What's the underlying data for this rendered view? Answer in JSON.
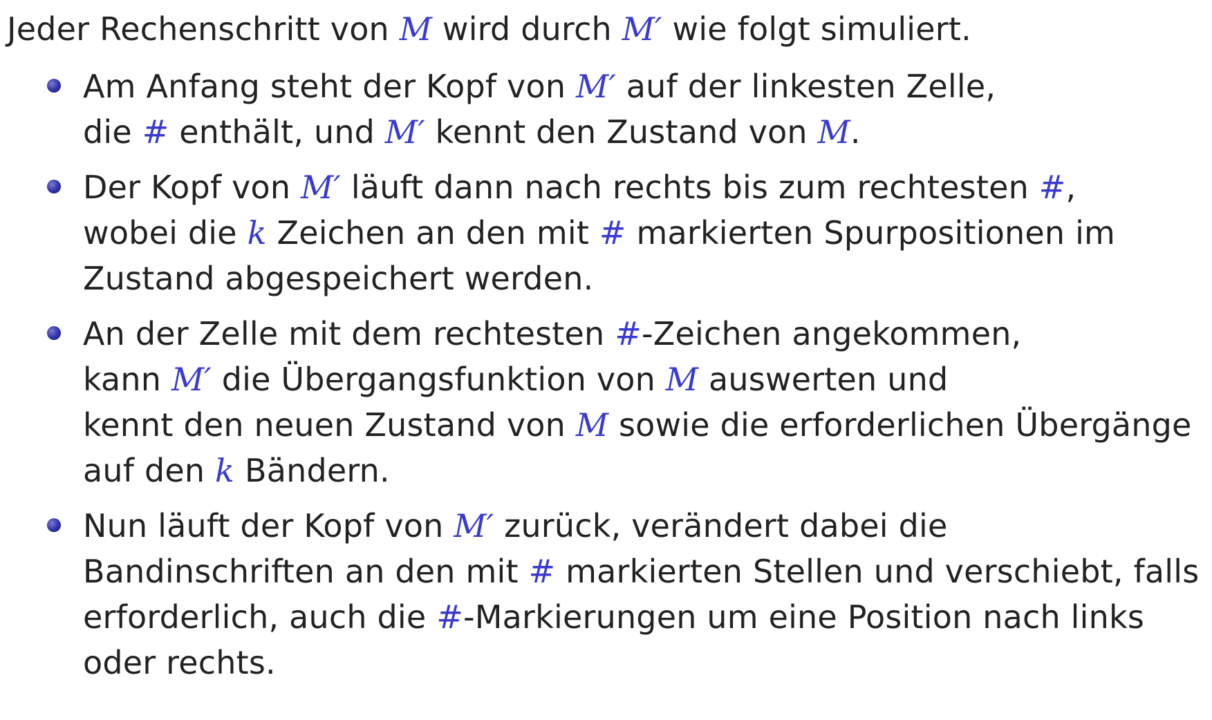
{
  "intro": {
    "parts": [
      "Jeder Rechenschritt von ",
      "M",
      " wird durch ",
      "M′",
      " wie folgt simuliert."
    ]
  },
  "bullets": [
    {
      "lines": [
        [
          "Am Anfang steht der Kopf von ",
          "M′",
          " auf der linkesten Zelle,"
        ],
        [
          "die ",
          "#",
          " enthält, und ",
          "M′",
          " kennt den Zustand von ",
          "M",
          "."
        ]
      ]
    },
    {
      "lines": [
        [
          "Der Kopf von ",
          "M′",
          " läuft dann nach rechts bis zum rechtesten ",
          "#",
          ","
        ],
        [
          "wobei die ",
          "k",
          " Zeichen an den mit ",
          "#",
          " markierten Spurpositionen im"
        ],
        [
          "Zustand abgespeichert werden."
        ]
      ]
    },
    {
      "lines": [
        [
          "An der Zelle mit dem rechtesten ",
          "#",
          "-Zeichen angekommen,"
        ],
        [
          "kann ",
          "M′",
          " die Übergangsfunktion von ",
          "M",
          " auswerten und"
        ],
        [
          "kennt den neuen Zustand von ",
          "M",
          " sowie die erforderlichen Übergänge"
        ],
        [
          "auf den ",
          "k",
          " Bändern."
        ]
      ]
    },
    {
      "lines": [
        [
          "Nun läuft der Kopf von ",
          "M′",
          " zurück, verändert dabei die"
        ],
        [
          "Bandinschriften an den mit ",
          "#",
          " markierten Stellen und verschiebt, falls"
        ],
        [
          "erforderlich, auch die ",
          "#",
          "-Markierungen um eine Position nach links"
        ],
        [
          "oder rechts."
        ]
      ]
    }
  ],
  "colors": {
    "text": "#222222",
    "math_accent": "#3a3ad0",
    "bullet": "#2f2fa8"
  }
}
